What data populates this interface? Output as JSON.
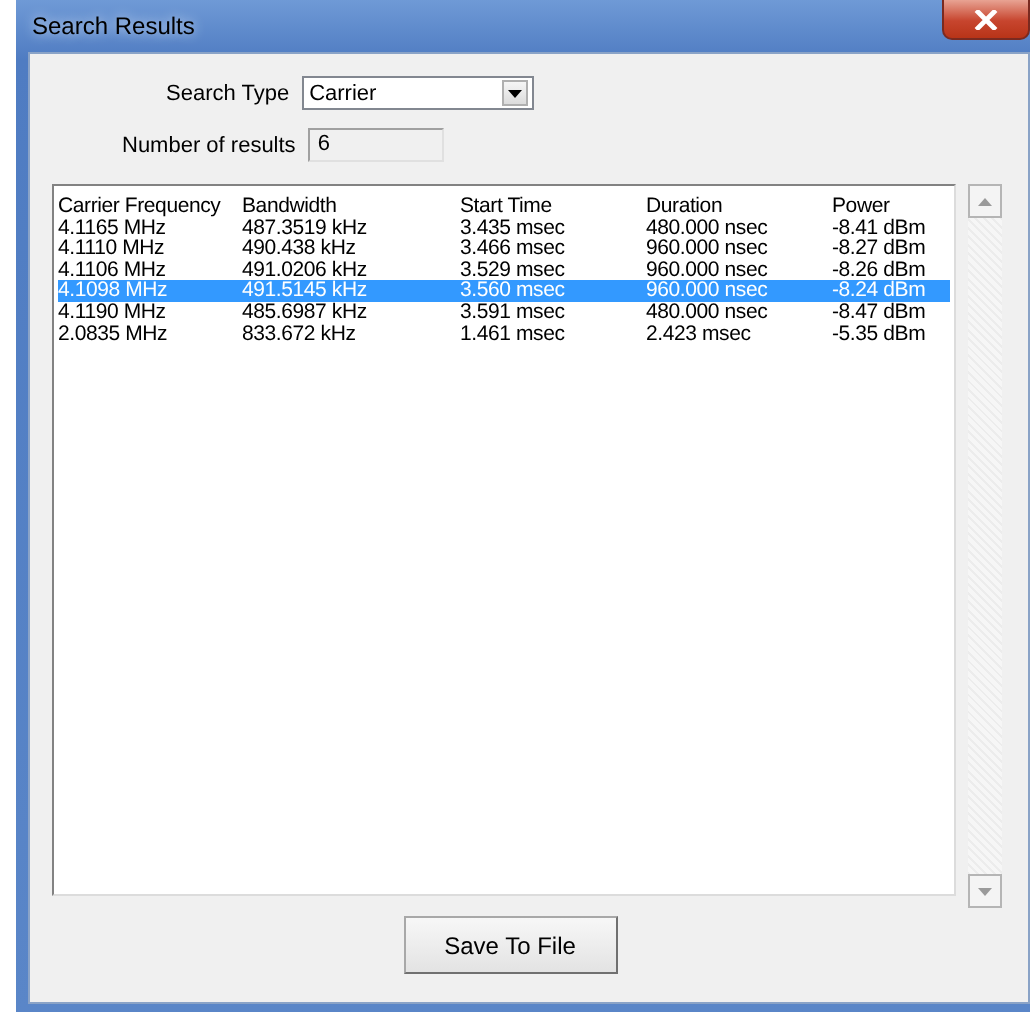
{
  "window": {
    "title": "Search Results"
  },
  "search_type": {
    "label": "Search Type",
    "value": "Carrier"
  },
  "result_count": {
    "label": "Number of results",
    "value": "6"
  },
  "results": {
    "columns": [
      "Carrier Frequency",
      "Bandwidth",
      "Start Time",
      "Duration",
      "Power"
    ],
    "rows": [
      {
        "cells": [
          "4.1165 MHz",
          "487.3519 kHz",
          "3.435 msec",
          "480.000 nsec",
          "-8.41 dBm"
        ],
        "selected": false
      },
      {
        "cells": [
          "4.1110 MHz",
          "490.438 kHz",
          "3.466 msec",
          "960.000 nsec",
          "-8.27 dBm"
        ],
        "selected": false
      },
      {
        "cells": [
          "4.1106 MHz",
          "491.0206 kHz",
          "3.529 msec",
          "960.000 nsec",
          "-8.26 dBm"
        ],
        "selected": false
      },
      {
        "cells": [
          "4.1098 MHz",
          "491.5145 kHz",
          "3.560 msec",
          "960.000 nsec",
          "-8.24 dBm"
        ],
        "selected": true
      },
      {
        "cells": [
          "4.1190 MHz",
          "485.6987 kHz",
          "3.591 msec",
          "480.000 nsec",
          "-8.47 dBm"
        ],
        "selected": false
      },
      {
        "cells": [
          "2.0835 MHz",
          "833.672 kHz",
          "1.461 msec",
          "2.423 msec",
          "-5.35 dBm"
        ],
        "selected": false
      }
    ]
  },
  "buttons": [
    "Save To File"
  ]
}
